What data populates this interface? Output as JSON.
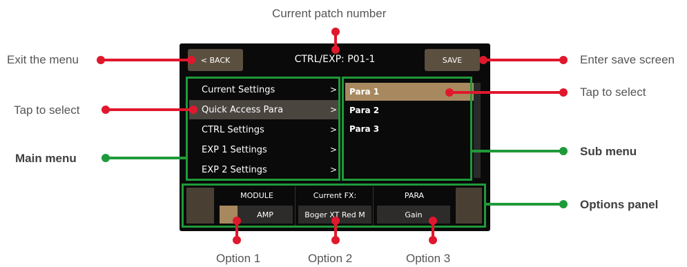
{
  "annotations": {
    "patch_number": "Current patch number",
    "exit_menu": "Exit the menu",
    "enter_save": "Enter save screen",
    "tap_select_left": "Tap to select",
    "tap_select_right": "Tap to select",
    "main_menu": "Main menu",
    "sub_menu": "Sub menu",
    "options_panel": "Options panel",
    "option1": "Option 1",
    "option2": "Option 2",
    "option3": "Option 3"
  },
  "header": {
    "back_label": "< BACK",
    "title": "CTRL/EXP: P01-1",
    "save_label": "SAVE"
  },
  "main_menu": {
    "items": [
      {
        "label": "Current Settings",
        "chevron": ">"
      },
      {
        "label": "Quick Access Para",
        "chevron": ">"
      },
      {
        "label": "CTRL Settings",
        "chevron": ">"
      },
      {
        "label": "EXP 1 Settings",
        "chevron": ">"
      },
      {
        "label": "EXP 2 Settings",
        "chevron": ">"
      }
    ]
  },
  "sub_menu": {
    "items": [
      {
        "label": "Para 1"
      },
      {
        "label": "Para 2"
      },
      {
        "label": "Para 3"
      }
    ]
  },
  "options": {
    "module_head": "MODULE",
    "module_value": "AMP",
    "fx_head": "Current FX:",
    "fx_value": "Boger XT Red M",
    "para_head": "PARA",
    "para_value": "Gain"
  },
  "colors": {
    "red": "#e0182d",
    "green": "#1f9a3a",
    "button": "#5b4f3f",
    "selected_sub": "#a8895f"
  }
}
